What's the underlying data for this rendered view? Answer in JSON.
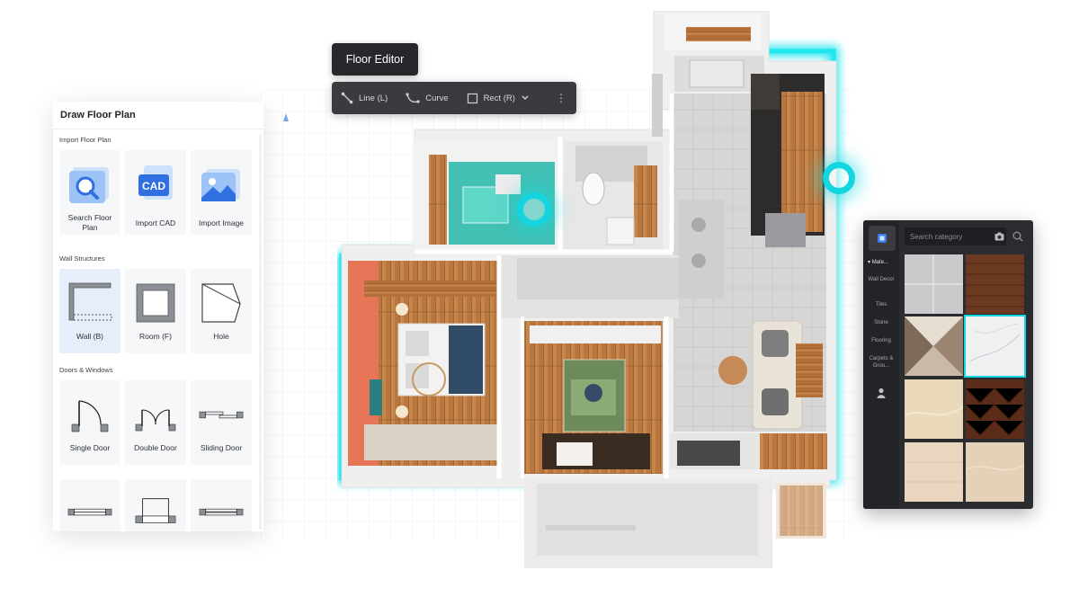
{
  "toolbar": {
    "title": "Floor Editor",
    "tools": [
      {
        "label": "Line (L)",
        "icon": "line-icon"
      },
      {
        "label": "Curve",
        "icon": "curve-icon"
      },
      {
        "label": "Rect (R)",
        "icon": "rect-icon"
      }
    ],
    "more": "⋮"
  },
  "left_panel": {
    "title": "Draw Floor Plan",
    "sections": [
      {
        "title": "Import Floor Plan",
        "items": [
          "Search Floor Plan",
          "Import CAD",
          "Import Image"
        ]
      },
      {
        "title": "Wall Structures",
        "items": [
          "Wall (B)",
          "Room (F)",
          "Hole"
        ]
      },
      {
        "title": "Doors & Windows",
        "items": [
          "Single Door",
          "Double Door",
          "Sliding Door"
        ]
      }
    ],
    "cad_text": "CAD"
  },
  "material_panel": {
    "search_placeholder": "Search category",
    "categories": [
      "Mate...",
      "Wall Decor",
      "Tiles",
      "Stone",
      "Flooring",
      "Carpets & Grou..."
    ],
    "accent": "#13d6e0"
  },
  "colors": {
    "accent_cyan": "#13d6e0",
    "toolbar_bg": "#3a3b3e",
    "selected_card": "#e6eefb"
  }
}
